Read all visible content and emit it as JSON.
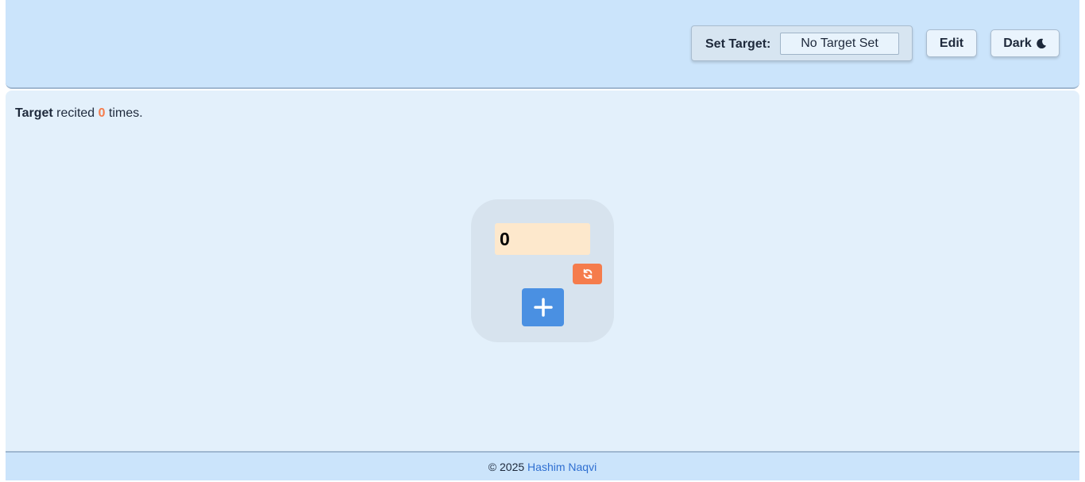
{
  "header": {
    "set_target_label": "Set Target:",
    "target_placeholder": "No Target Set",
    "target_value": "",
    "edit_label": "Edit",
    "dark_label": "Dark",
    "dark_icon": "moon-icon"
  },
  "status": {
    "target_word": "Target",
    "recited_word": "recited",
    "count": "0",
    "times_word": "times."
  },
  "counter": {
    "value": "0",
    "reset_icon": "refresh-icon",
    "increment_icon": "plus-icon"
  },
  "footer": {
    "copyright": "© 2025",
    "author": "Hashim Naqvi"
  },
  "colors": {
    "header_bg": "#cbe4fb",
    "main_bg": "#e3f0fb",
    "accent_orange": "#f57c4c",
    "accent_blue": "#4a90e2",
    "display_bg": "#fde8cc"
  }
}
